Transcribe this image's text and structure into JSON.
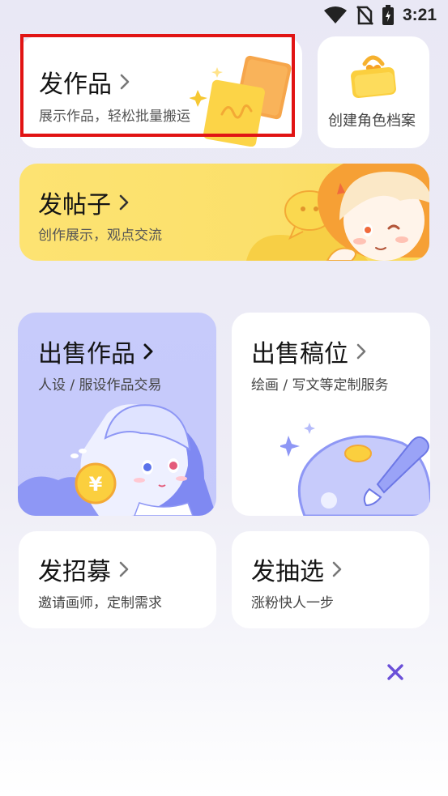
{
  "status_bar": {
    "time": "3:21"
  },
  "cards": {
    "post_work": {
      "title": "发作品",
      "subtitle": "展示作品，轻松批量搬运"
    },
    "create_role": {
      "label": "创建角色档案"
    },
    "post_thread": {
      "title": "发帖子",
      "subtitle": "创作展示，观点交流"
    },
    "sell_work": {
      "title": "出售作品",
      "subtitle": "人设 / 服设作品交易"
    },
    "sell_slot": {
      "title": "出售稿位",
      "subtitle": "绘画 / 写文等定制服务"
    },
    "recruit": {
      "title": "发招募",
      "subtitle": "邀请画师，定制需求"
    },
    "lottery": {
      "title": "发抽选",
      "subtitle": "涨粉快人一步"
    }
  },
  "colors": {
    "accent_close": "#6a4fd8",
    "highlight_border": "#e11414",
    "thread_card_bg": "#fde372",
    "sell_card_bg": "#c7cbfb"
  },
  "icons": [
    "wifi-icon",
    "no-sim-icon",
    "battery-icon",
    "chevron-right-icon",
    "close-icon",
    "paper-stack-icon",
    "folder-heart-icon",
    "speech-bubble-icon",
    "yuan-coin-icon",
    "palette-icon"
  ]
}
